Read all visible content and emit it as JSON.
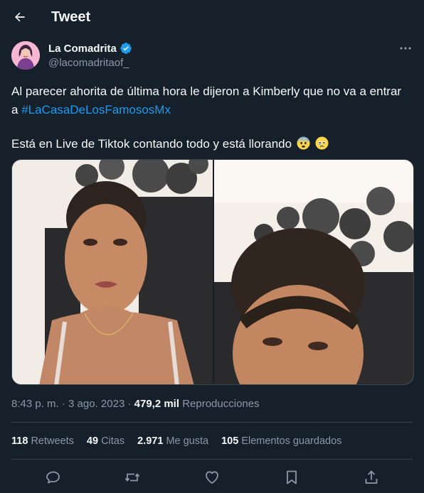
{
  "header": {
    "title": "Tweet"
  },
  "author": {
    "name": "La Comadrita",
    "handle": "@lacomadritaof_"
  },
  "tweet": {
    "line1": "Al parecer ahorita de última hora le dijeron a Kimberly que no va a entrar",
    "line2_prefix": "a ",
    "hashtag": "#LaCasaDeLosFamososMx",
    "line3": "Está en Live de Tiktok contando todo y está llorando",
    "emojis": [
      "anxious-face-with-sweat",
      "face-holding-back-tears"
    ]
  },
  "meta": {
    "time": "8:43 p. m.",
    "sep1": "·",
    "date": "3 ago. 2023",
    "sep2": "·",
    "views": "479,2 mil",
    "views_label": "Reproducciones"
  },
  "stats": [
    {
      "count": "118",
      "label": "Retweets"
    },
    {
      "count": "49",
      "label": "Citas"
    },
    {
      "count": "2.971",
      "label": "Me gusta"
    },
    {
      "count": "105",
      "label": "Elementos guardados"
    }
  ],
  "actions": [
    "reply-icon",
    "retweet-icon",
    "like-icon",
    "bookmark-icon",
    "share-icon"
  ]
}
